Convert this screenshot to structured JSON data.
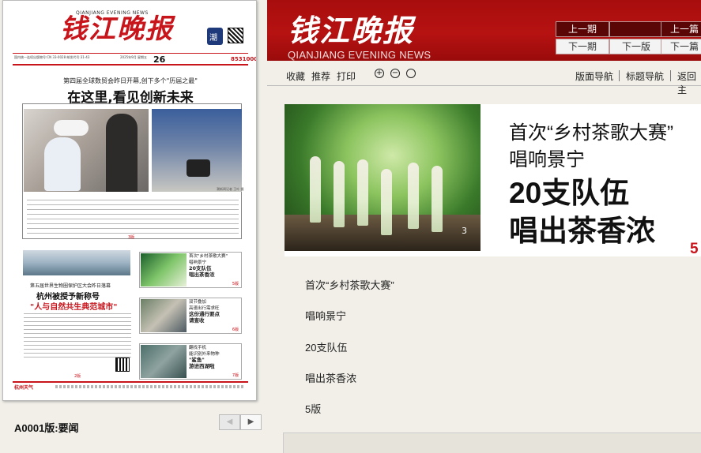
{
  "paper": {
    "logo": "钱江晚报",
    "logo_en": "QIANJIANG EVENING NEWS",
    "info_left": "国内统一连续出版物号:CN 33-0028 邮发代号:31-43",
    "info_date": "2025年9月 星期五",
    "page_number": "26",
    "phone": "85310000",
    "kicker": "第四届全球数贸会昨日开幕,创下多个\"历届之最\"",
    "headline": "在这里,看见创新未来",
    "photo_caption": "潮新闻记者 王叶 摄",
    "page_ref_3": "3版",
    "sub2": "第五届世界生物圈保护区大会昨日落幕",
    "headline2a": "杭州被授予新称号",
    "headline2b": "\"人与自然共生典范城市\"",
    "page_ref_2": "2版",
    "teasers": [
      {
        "lines": [
          "首次\"乡村茶歌大赛\"",
          "唱响景宁"
        ],
        "bold": [
          "20支队伍",
          "唱出茶香浓"
        ],
        "page": "5版"
      },
      {
        "lines": [
          "双节叠加",
          "高速出行需求旺"
        ],
        "bold": [
          "这份通行要点",
          "请查收"
        ],
        "page": "6版"
      },
      {
        "lines": [
          "翻找手机",
          "能识别外来物种"
        ],
        "bold": [
          "\"鲨鱼\"",
          "游进西湖啦"
        ],
        "page": "7版"
      }
    ],
    "footer_weather": "杭州天气"
  },
  "edition_label": "A0001版:要闻",
  "pager": {
    "prev": "◀",
    "next": "▶"
  },
  "brand": {
    "cn": "钱江晚报",
    "en": "QIANJIANG EVENING NEWS"
  },
  "nav": {
    "prev_issue": "上一期",
    "next_issue": "下一期",
    "prev_page": "",
    "next_page": "下一版",
    "prev_article": "上一篇",
    "next_article": "下一篇"
  },
  "toolbar": {
    "collect": "收藏",
    "recommend": "推荐",
    "print": "打印",
    "zoom_in": "+",
    "zoom_out": "−",
    "zoom_reset": "○",
    "page_nav": "版面导航",
    "title_nav": "标题导航",
    "back": "返回主"
  },
  "feature": {
    "title_line1": "首次“乡村茶歌大赛”",
    "title_line2": "唱响景宁",
    "title_line3": "20支队伍",
    "title_line4": "唱出茶香浓",
    "page": "5",
    "photo_num": "3"
  },
  "article_lines": [
    "首次“乡村茶歌大赛”",
    "唱响景宁",
    "20支队伍",
    "唱出茶香浓",
    "5版"
  ],
  "colors": {
    "brand_red": "#b61212",
    "accent_red": "#c8141b",
    "bg": "#f1efe8"
  }
}
